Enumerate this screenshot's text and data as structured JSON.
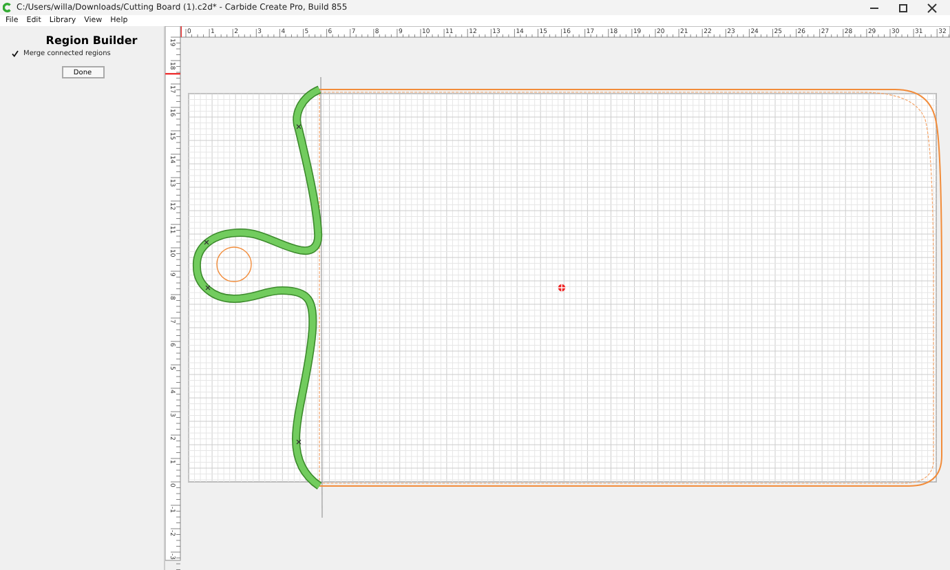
{
  "window": {
    "title": "C:/Users/willa/Downloads/Cutting Board (1).c2d* - Carbide Create Pro, Build 855"
  },
  "menu": [
    "File",
    "Edit",
    "Library",
    "View",
    "Help"
  ],
  "panel": {
    "title": "Region Builder",
    "merge": {
      "label": "Merge connected regions",
      "checked": true
    },
    "button": "Done"
  },
  "rulers": {
    "horizontal": [
      "0",
      "1",
      "2",
      "3",
      "4",
      "5",
      "6",
      "7",
      "8",
      "9",
      "10",
      "11",
      "12",
      "13",
      "14",
      "15",
      "16",
      "17",
      "18",
      "19",
      "20",
      "21",
      "22",
      "23",
      "24",
      "25",
      "26",
      "27",
      "28",
      "29",
      "30",
      "31",
      "32"
    ],
    "vertical": [
      "19",
      "18",
      "17",
      "16",
      "15",
      "14",
      "13",
      "12",
      "11",
      "10",
      "9",
      "8",
      "7",
      "6",
      "5",
      "4",
      "3",
      "2",
      "1",
      "0",
      "-1",
      "-2",
      "-3"
    ]
  }
}
